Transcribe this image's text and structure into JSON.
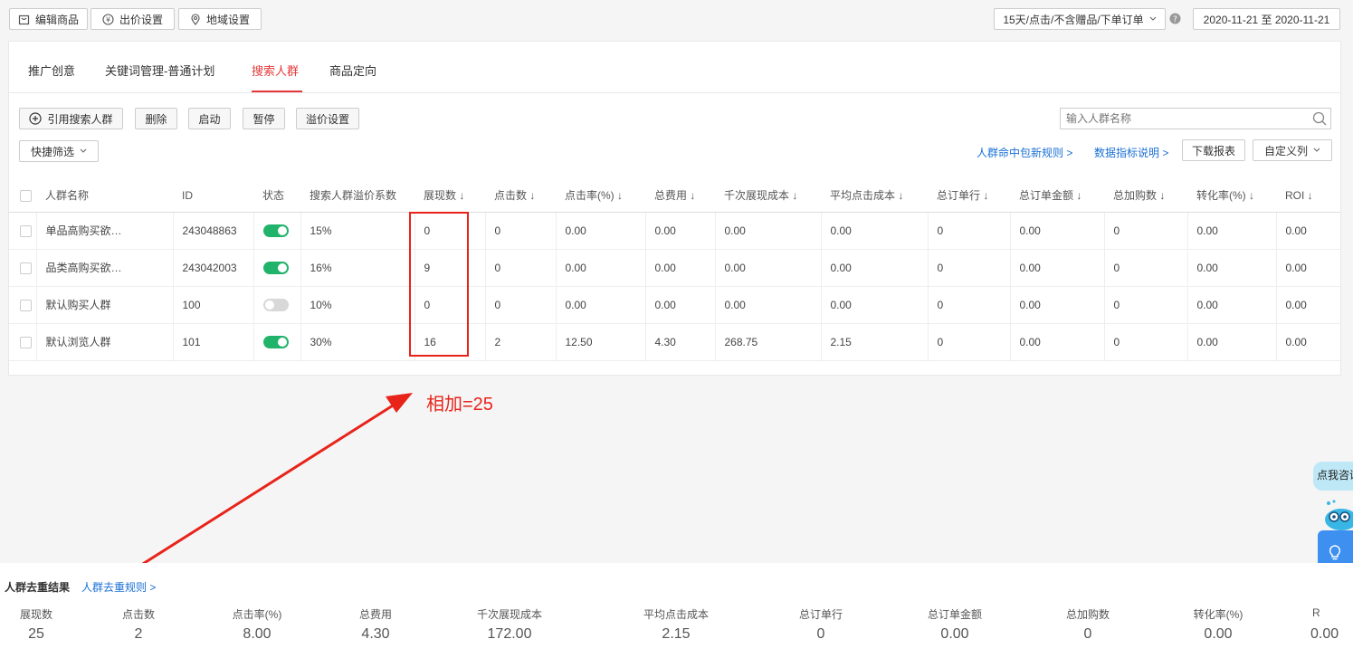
{
  "topbar": {
    "edit_goods": "编辑商品",
    "bid_settings": "出价设置",
    "region_settings": "地域设置",
    "attribution": "15天/点击/不含赠品/下单订单",
    "date_range": "2020-11-21 至 2020-11-21"
  },
  "tabs": [
    "推广创意",
    "关键词管理-普通计划",
    "搜索人群",
    "商品定向"
  ],
  "active_tab": "搜索人群",
  "toolbar": {
    "add_crowd": "引用搜索人群",
    "delete": "删除",
    "start": "启动",
    "pause": "暂停",
    "premium": "溢价设置",
    "search_placeholder": "输入人群名称",
    "quick_filter": "快捷筛选",
    "rule_link": "人群命中包新规则 >",
    "metric_link": "数据指标说明 >",
    "download": "下载报表",
    "custom_columns": "自定义列"
  },
  "table": {
    "headers": [
      "人群名称",
      "ID",
      "状态",
      "搜索人群溢价系数",
      "展现数 ↓",
      "点击数 ↓",
      "点击率(%) ↓",
      "总费用 ↓",
      "千次展现成本 ↓",
      "平均点击成本 ↓",
      "总订单行 ↓",
      "总订单金额 ↓",
      "总加购数 ↓",
      "转化率(%) ↓",
      "ROI ↓"
    ],
    "rows": [
      {
        "name": "单品高购买欲…",
        "id": "243048863",
        "status": "on",
        "premium": "15%",
        "impr": "0",
        "clicks": "0",
        "ctr": "0.00",
        "cost": "0.00",
        "cpm": "0.00",
        "cpc": "0.00",
        "orders": "0",
        "order_amt": "0.00",
        "cart": "0",
        "cvr": "0.00",
        "roi": "0.00"
      },
      {
        "name": "品类高购买欲…",
        "id": "243042003",
        "status": "on",
        "premium": "16%",
        "impr": "9",
        "clicks": "0",
        "ctr": "0.00",
        "cost": "0.00",
        "cpm": "0.00",
        "cpc": "0.00",
        "orders": "0",
        "order_amt": "0.00",
        "cart": "0",
        "cvr": "0.00",
        "roi": "0.00"
      },
      {
        "name": "默认购买人群",
        "id": "100",
        "status": "off",
        "premium": "10%",
        "impr": "0",
        "clicks": "0",
        "ctr": "0.00",
        "cost": "0.00",
        "cpm": "0.00",
        "cpc": "0.00",
        "orders": "0",
        "order_amt": "0.00",
        "cart": "0",
        "cvr": "0.00",
        "roi": "0.00"
      },
      {
        "name": "默认浏览人群",
        "id": "101",
        "status": "on",
        "premium": "30%",
        "impr": "16",
        "clicks": "2",
        "ctr": "12.50",
        "cost": "4.30",
        "cpm": "268.75",
        "cpc": "2.15",
        "orders": "0",
        "order_amt": "0.00",
        "cart": "0",
        "cvr": "0.00",
        "roi": "0.00"
      }
    ]
  },
  "annotation": {
    "text": "相加=25",
    "color": "#e8231a"
  },
  "consult": {
    "label": "点我咨询"
  },
  "summary": {
    "title": "人群去重结果",
    "rule_link": "人群去重规则 >",
    "labels": [
      "展现数",
      "点击数",
      "点击率(%)",
      "总费用",
      "千次展现成本",
      "平均点击成本",
      "总订单行",
      "总订单金额",
      "总加购数",
      "转化率(%)",
      "R"
    ],
    "values": [
      "25",
      "2",
      "8.00",
      "4.30",
      "172.00",
      "2.15",
      "0",
      "0.00",
      "0",
      "0.00",
      "0.00"
    ]
  },
  "colors": {
    "accent": "#e4393c",
    "link": "#1a6fd4",
    "toggle_on": "#22b36b"
  }
}
